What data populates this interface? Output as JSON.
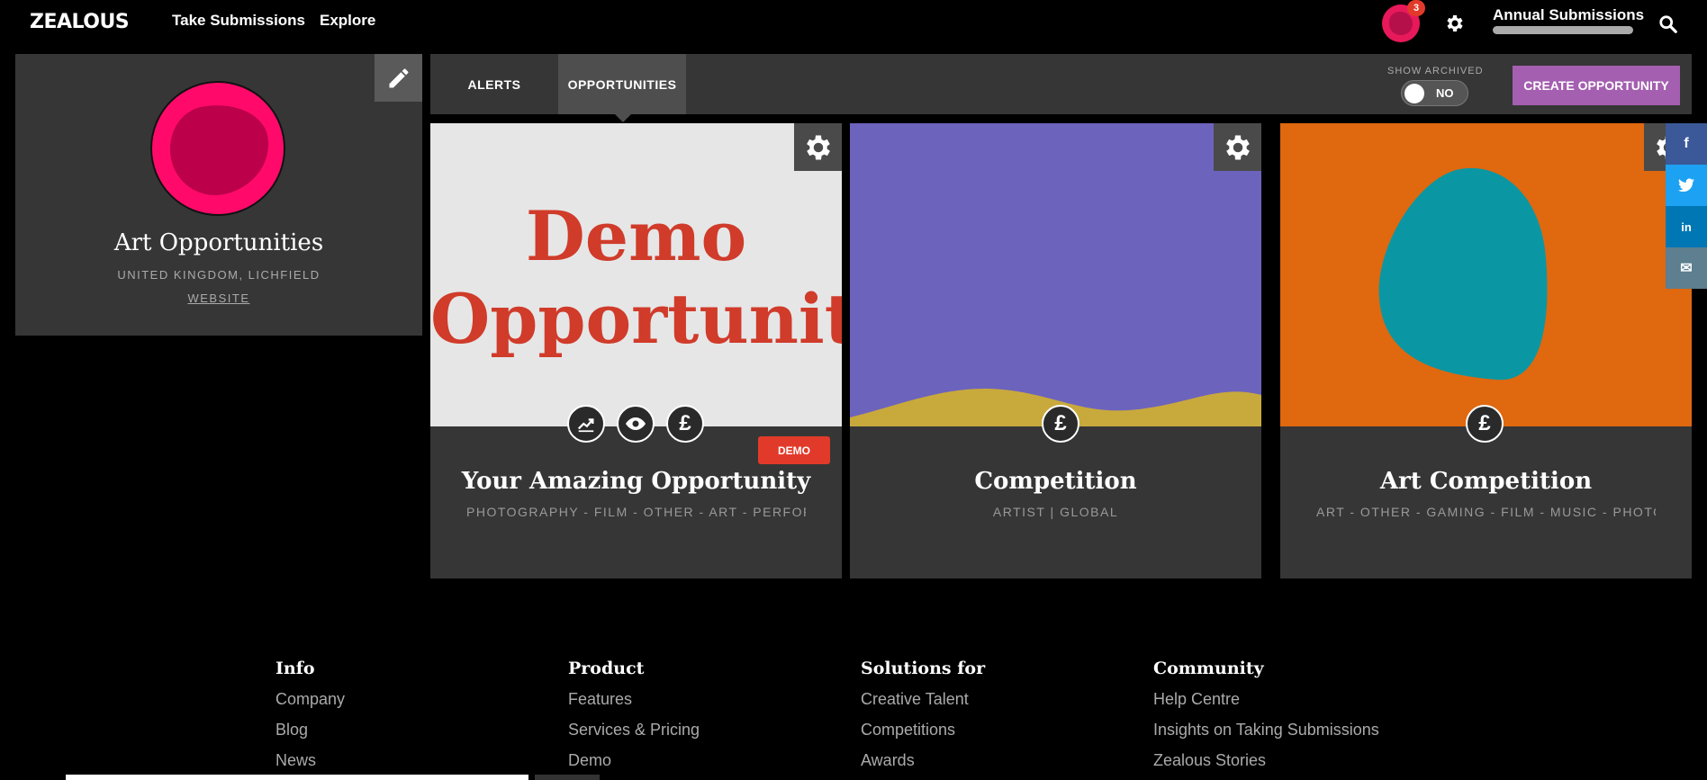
{
  "nav": {
    "logo": "ZEALOUS",
    "links": [
      "Take Submissions",
      "Explore"
    ],
    "notifications": "3",
    "account_name": "Annual Submissions"
  },
  "profile": {
    "title": "Art Opportunities",
    "location": "UNITED KINGDOM, LICHFIELD",
    "website": "WEBSITE"
  },
  "tabs": {
    "alerts": "ALERTS",
    "opportunities": "OPPORTUNITIES",
    "active": "OPPORTUNITIES"
  },
  "archived": {
    "label": "SHOW ARCHIVED",
    "value": "NO"
  },
  "create_button": "CREATE OPPORTUNITY",
  "cards": [
    {
      "image_text_line1": "Demo",
      "image_text_line2": "Opportunity",
      "title": "Your Amazing Opportunity",
      "tags": "PHOTOGRAPHY - FILM - OTHER - ART - PERFORMING ARTS",
      "badge": "DEMO",
      "icons": [
        "stats-icon",
        "eye-icon",
        "pound-icon"
      ],
      "image_bg": "#e6e6e6"
    },
    {
      "title": "Competition",
      "tags": "ARTIST | GLOBAL",
      "icons": [
        "pound-icon"
      ],
      "image_bg": "#6c63bd",
      "wave_color": "#c8a93c"
    },
    {
      "title": "Art Competition",
      "tags": "ART - OTHER - GAMING - FILM - MUSIC - PHOTOGRAPHY",
      "icons": [
        "pound-icon"
      ],
      "image_bg": "#e0680f",
      "blob_color": "#0a97a3"
    }
  ],
  "currency_symbol": "£",
  "social": [
    {
      "name": "facebook",
      "glyph": "f",
      "color": "#3b5998"
    },
    {
      "name": "twitter",
      "glyph": "t",
      "color": "#1da1f2"
    },
    {
      "name": "linkedin",
      "glyph": "in",
      "color": "#0077b5"
    },
    {
      "name": "email",
      "glyph": "✉",
      "color": "#5d7f8f"
    }
  ],
  "footer": {
    "info": {
      "heading": "Info",
      "links": [
        "Company",
        "Blog",
        "News"
      ]
    },
    "product": {
      "heading": "Product",
      "links": [
        "Features",
        "Services & Pricing",
        "Demo"
      ]
    },
    "solutions": {
      "heading": "Solutions for",
      "links": [
        "Creative Talent",
        "Competitions",
        "Awards"
      ]
    },
    "community": {
      "heading": "Community",
      "links": [
        "Help Centre",
        "Insights on Taking Submissions",
        "Zealous Stories"
      ]
    }
  },
  "colors": {
    "brand_pink": "#ff0a6a",
    "create_purple": "#a45fb0",
    "demo_red": "#e23a2a",
    "panel": "#363636"
  }
}
